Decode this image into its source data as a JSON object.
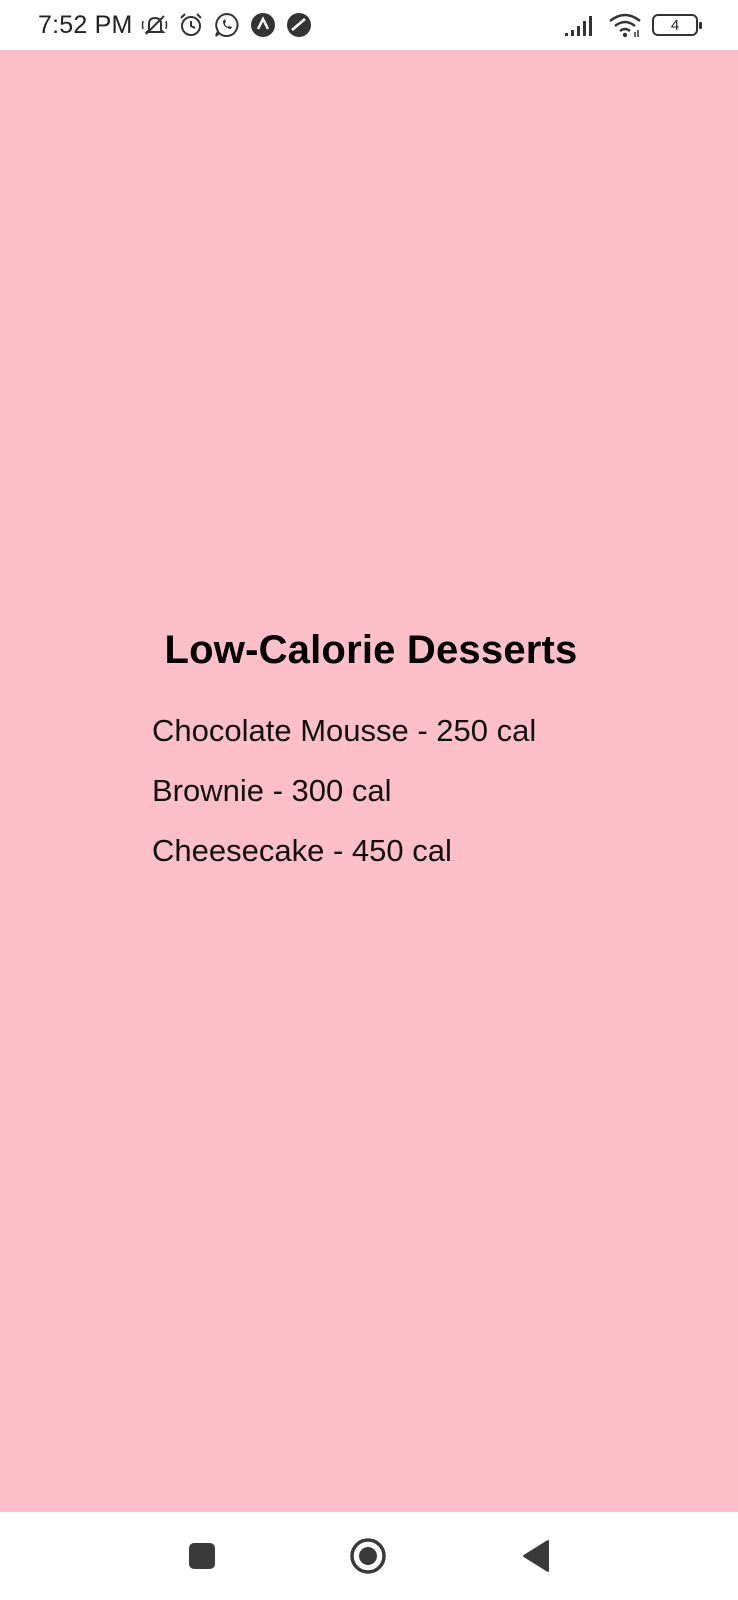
{
  "status_bar": {
    "time": "7:52 PM",
    "icons_left": [
      "mute-icon",
      "alarm-icon",
      "whatsapp-icon",
      "app-a-icon",
      "circle-app-icon"
    ],
    "icons_right": [
      "signal-icon",
      "wifi-icon",
      "battery-icon"
    ],
    "battery_level": "4"
  },
  "main": {
    "background_color": "#fdbfca",
    "title": "Low-Calorie Desserts",
    "items": [
      "Chocolate Mousse - 250 cal",
      "Brownie - 300 cal",
      "Cheesecake - 450 cal"
    ]
  },
  "nav_bar": {
    "buttons": [
      "recent-apps",
      "home",
      "back"
    ]
  }
}
